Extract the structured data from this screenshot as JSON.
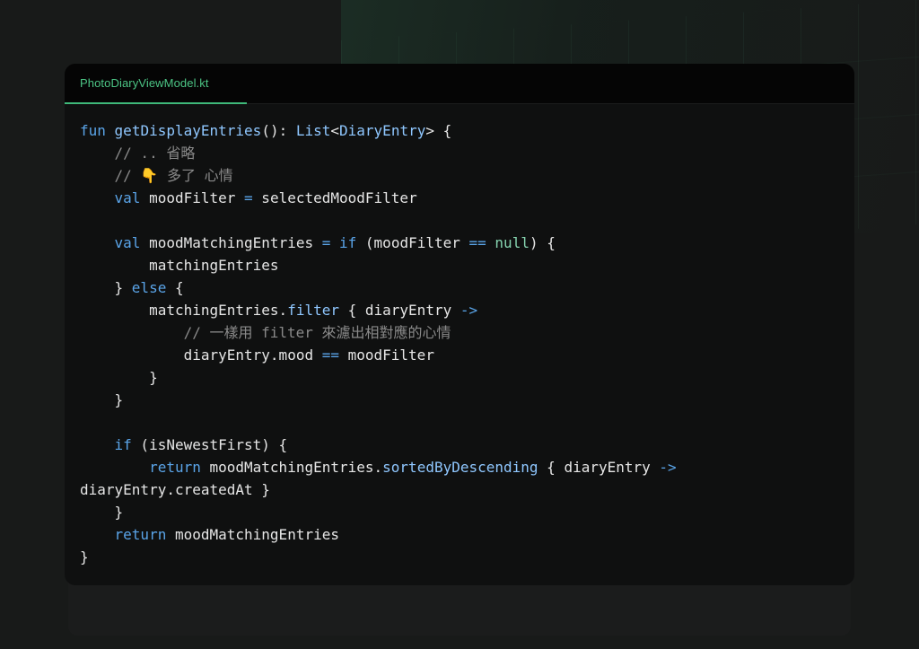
{
  "editor": {
    "tab": {
      "filename": "PhotoDiaryViewModel.kt",
      "active": true
    },
    "accent_color": "#3fb97a",
    "code_lines": [
      [
        {
          "t": "fun",
          "c": "kw"
        },
        {
          "t": " ",
          "c": "tx"
        },
        {
          "t": "getDisplayEntries",
          "c": "fn"
        },
        {
          "t": "(): ",
          "c": "tx"
        },
        {
          "t": "List",
          "c": "ty"
        },
        {
          "t": "<",
          "c": "tx"
        },
        {
          "t": "DiaryEntry",
          "c": "ty"
        },
        {
          "t": "> {",
          "c": "tx"
        }
      ],
      [
        {
          "t": "    // .. 省略",
          "c": "cm"
        }
      ],
      [
        {
          "t": "    // 👇 多了 心情",
          "c": "cm"
        }
      ],
      [
        {
          "t": "    ",
          "c": "tx"
        },
        {
          "t": "val",
          "c": "kw"
        },
        {
          "t": " moodFilter ",
          "c": "tx"
        },
        {
          "t": "=",
          "c": "op"
        },
        {
          "t": " selectedMoodFilter",
          "c": "tx"
        }
      ],
      [],
      [
        {
          "t": "    ",
          "c": "tx"
        },
        {
          "t": "val",
          "c": "kw"
        },
        {
          "t": " moodMatchingEntries ",
          "c": "tx"
        },
        {
          "t": "=",
          "c": "op"
        },
        {
          "t": " ",
          "c": "tx"
        },
        {
          "t": "if",
          "c": "kw"
        },
        {
          "t": " (moodFilter ",
          "c": "tx"
        },
        {
          "t": "==",
          "c": "op"
        },
        {
          "t": " ",
          "c": "tx"
        },
        {
          "t": "null",
          "c": "lit"
        },
        {
          "t": ") {",
          "c": "tx"
        }
      ],
      [
        {
          "t": "        matchingEntries",
          "c": "tx"
        }
      ],
      [
        {
          "t": "    } ",
          "c": "tx"
        },
        {
          "t": "else",
          "c": "kw"
        },
        {
          "t": " {",
          "c": "tx"
        }
      ],
      [
        {
          "t": "        matchingEntries.",
          "c": "tx"
        },
        {
          "t": "filter",
          "c": "fn"
        },
        {
          "t": " { diaryEntry ",
          "c": "tx"
        },
        {
          "t": "->",
          "c": "op"
        }
      ],
      [
        {
          "t": "            // 一樣用 filter 來濾出相對應的心情",
          "c": "cm"
        }
      ],
      [
        {
          "t": "            diaryEntry.mood ",
          "c": "tx"
        },
        {
          "t": "==",
          "c": "op"
        },
        {
          "t": " moodFilter",
          "c": "tx"
        }
      ],
      [
        {
          "t": "        }",
          "c": "tx"
        }
      ],
      [
        {
          "t": "    }",
          "c": "tx"
        }
      ],
      [],
      [
        {
          "t": "    ",
          "c": "tx"
        },
        {
          "t": "if",
          "c": "kw"
        },
        {
          "t": " (isNewestFirst) {",
          "c": "tx"
        }
      ],
      [
        {
          "t": "        ",
          "c": "tx"
        },
        {
          "t": "return",
          "c": "kw"
        },
        {
          "t": " moodMatchingEntries.",
          "c": "tx"
        },
        {
          "t": "sortedByDescending",
          "c": "fn"
        },
        {
          "t": " { diaryEntry ",
          "c": "tx"
        },
        {
          "t": "->",
          "c": "op"
        }
      ],
      [
        {
          "t": "diaryEntry.createdAt }",
          "c": "tx"
        }
      ],
      [
        {
          "t": "    }",
          "c": "tx"
        }
      ],
      [
        {
          "t": "    ",
          "c": "tx"
        },
        {
          "t": "return",
          "c": "kw"
        },
        {
          "t": " moodMatchingEntries",
          "c": "tx"
        }
      ],
      [
        {
          "t": "}",
          "c": "tx"
        }
      ]
    ]
  }
}
